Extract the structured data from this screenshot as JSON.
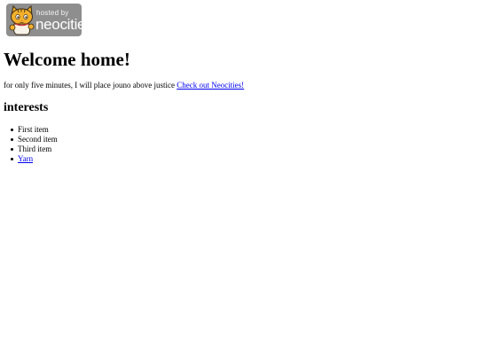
{
  "badge": {
    "line1": "hosted by",
    "line2": "neocities",
    "colors": {
      "background": "#8e8e8e",
      "cat_body": "#f2b02c",
      "cat_outline": "#3a2a14"
    }
  },
  "heading": "Welcome home!",
  "intro": {
    "text": "for only five minutes, I will place jouno above justice",
    "link_label": "Check out Neocities!"
  },
  "interests": {
    "heading": "interests",
    "items": [
      {
        "label": "First item",
        "is_link": false
      },
      {
        "label": "Second item",
        "is_link": false
      },
      {
        "label": "Third item",
        "is_link": false
      },
      {
        "label": "Yarn",
        "is_link": true
      }
    ]
  },
  "colors": {
    "text": "#000000",
    "link": "#0000ee",
    "background": "#ffffff"
  }
}
